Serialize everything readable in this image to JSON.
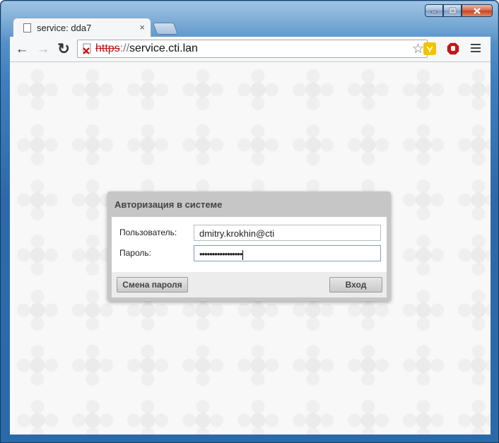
{
  "window": {
    "controls": [
      "minimize",
      "maximize",
      "close"
    ]
  },
  "tab": {
    "title": "service: dda7",
    "close_glyph": "×"
  },
  "toolbar": {
    "back_glyph": "←",
    "forward_glyph": "→",
    "reload_glyph": "↻",
    "url_protocol": "https",
    "url_separator": "://",
    "url_host": "service.cti.lan",
    "star_glyph": "☆",
    "security_state": "insecure"
  },
  "dialog": {
    "title": "Авторизация в системе",
    "username_label": "Пользователь:",
    "username_value": "dmitry.krokhin@cti",
    "password_label": "Пароль:",
    "password_value": "•••••••••••••••••",
    "change_password_button": "Смена пароля",
    "login_button": "Вход"
  },
  "colors": {
    "frame": "#2a6aa8",
    "dialog_header": "#c6c6c6",
    "insecure_protocol": "#bb1111"
  }
}
